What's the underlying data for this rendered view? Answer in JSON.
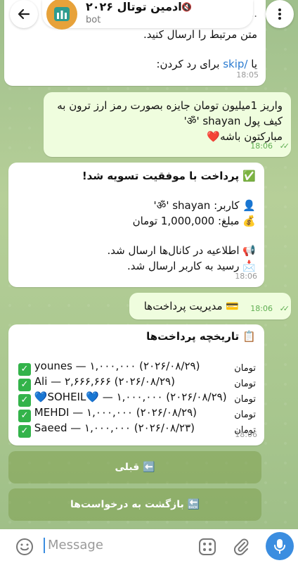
{
  "header": {
    "title": "ادمین توتال ۲۰۲۶",
    "subtitle": "bot"
  },
  "messages": {
    "m1": {
      "line1_partial": "...ها",
      "line2": "متن مرتبط را ارسال کنید.",
      "line3_pre": "یا ",
      "line3_link": "/skip",
      "line3_post": " برای رد کردن:",
      "time": "18:05"
    },
    "m2": {
      "line1": "واریز 1میلیون تومان جایزه بصورت رمز ارز ترون به",
      "line2": "کیف پول ॐ' shayan'",
      "line3": "مبارکتون باشه❤️",
      "time": "18:06"
    },
    "m3": {
      "title": "✅ پرداخت با موفقیت تسویه شد!",
      "user": "👤 کاربر: ॐ' shayan'",
      "amount": "💰 مبلغ: 1,000,000 تومان",
      "notice1": "📢 اطلاعیه در کانال‌ها ارسال شد.",
      "notice2": "📩 رسید به کاربر ارسال شد.",
      "time": "18:06"
    },
    "m4": {
      "text": "💳 مدیریت پرداخت‌ها",
      "time": "18:06"
    },
    "m5": {
      "title": "📋 تاریخچه پرداخت‌ها",
      "rows": [
        {
          "name": "younes",
          "amount": "۱,۰۰۰,۰۰۰",
          "date": "(۲۰۲۶/۰۸/۲۹)",
          "unit": "تومان"
        },
        {
          "name": "Ali",
          "amount": "۲,۶۶۶,۶۶۶",
          "date": "(۲۰۲۶/۰۸/۲۹)",
          "unit": "تومان"
        },
        {
          "name": "💙SOHEIL💙",
          "amount": "۱,۰۰۰,۰۰۰",
          "date": "(۲۰۲۶/۰۸/۲۹)",
          "unit": "تومان"
        },
        {
          "name": "MEHDI",
          "amount": "۱,۰۰۰,۰۰۰",
          "date": "(۲۰۲۶/۰۸/۲۹)",
          "unit": "تومان"
        },
        {
          "name": "Saeed",
          "amount": "۱,۰۰۰,۰۰۰",
          "date": "(۲۰۲۶/۰۸/۲۳)",
          "unit": "تومان"
        }
      ],
      "time": "18:06"
    }
  },
  "keyboard": {
    "prev": "⬅️ قبلی",
    "back": "🔙 بازگشت به درخواست‌ها"
  },
  "composer": {
    "placeholder": "Message"
  },
  "colors": {
    "accent": "#3b8de0",
    "outgoing_bubble": "#effdde",
    "check_green": "#33b34a"
  }
}
